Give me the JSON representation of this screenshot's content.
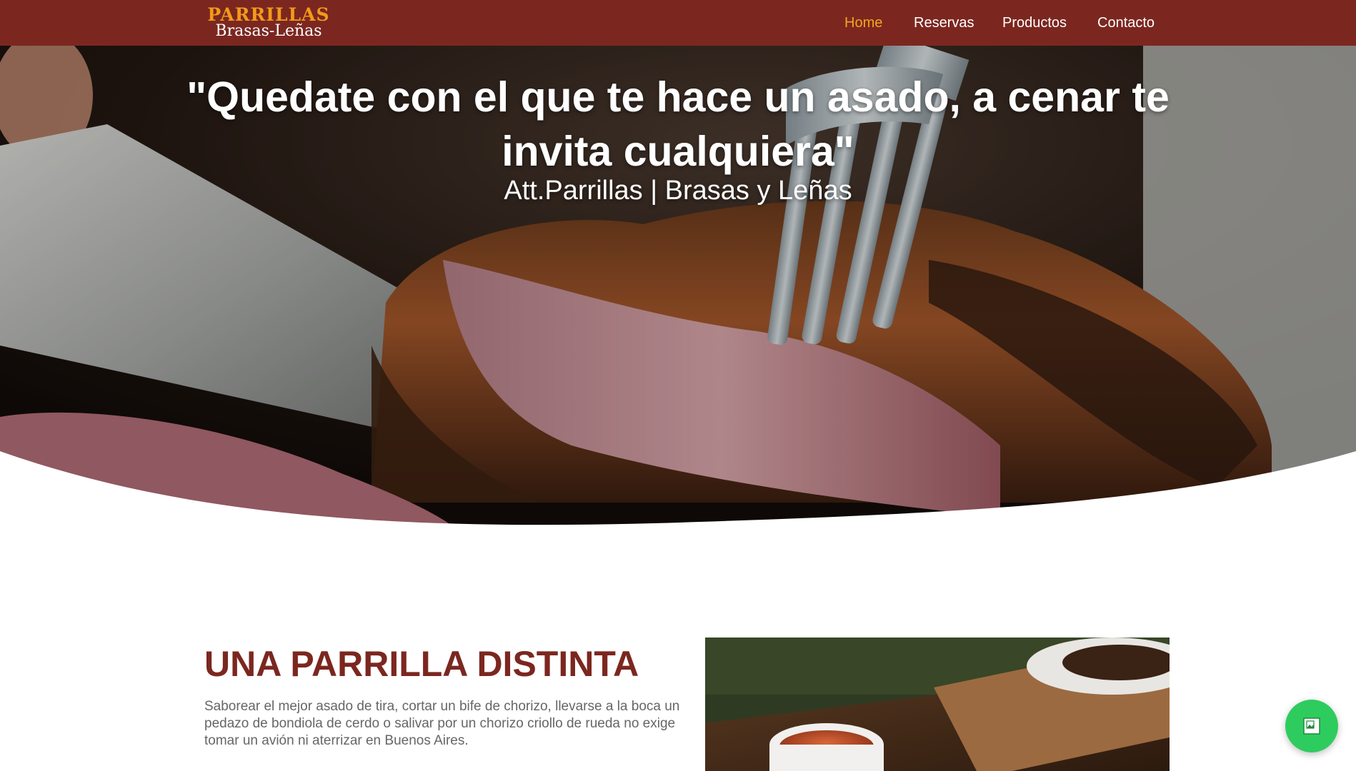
{
  "header": {
    "brand_top": "PARRILLAS",
    "brand_bottom": "Brasas-Leñas",
    "nav": [
      {
        "label": "Home",
        "active": true
      },
      {
        "label": "Reservas",
        "active": false
      },
      {
        "label": "Productos",
        "active": false
      },
      {
        "label": "Contacto",
        "active": false
      }
    ]
  },
  "hero": {
    "quote": "\"Quedate con el que te hace un asado, a cenar te invita cualquiera\"",
    "signature": "Att.Parrillas | Brasas y Leñas"
  },
  "about": {
    "title": "UNA PARRILLA DISTINTA",
    "paragraph_1": "Saborear el mejor asado de tira, cortar un bife de chorizo, llevarse a la boca un pedazo de bondiola de cerdo o salivar por un chorizo criollo de rueda no exige tomar un avión ni aterrizar en Buenos Aires."
  },
  "fab": {
    "icon": "image-placeholder-icon"
  },
  "colors": {
    "header_bg": "#7b2720",
    "brand_accent": "#f29a1a",
    "nav_active": "#f4a51c",
    "title_color": "#7b2720",
    "fab_bg": "#2ecc5e"
  }
}
